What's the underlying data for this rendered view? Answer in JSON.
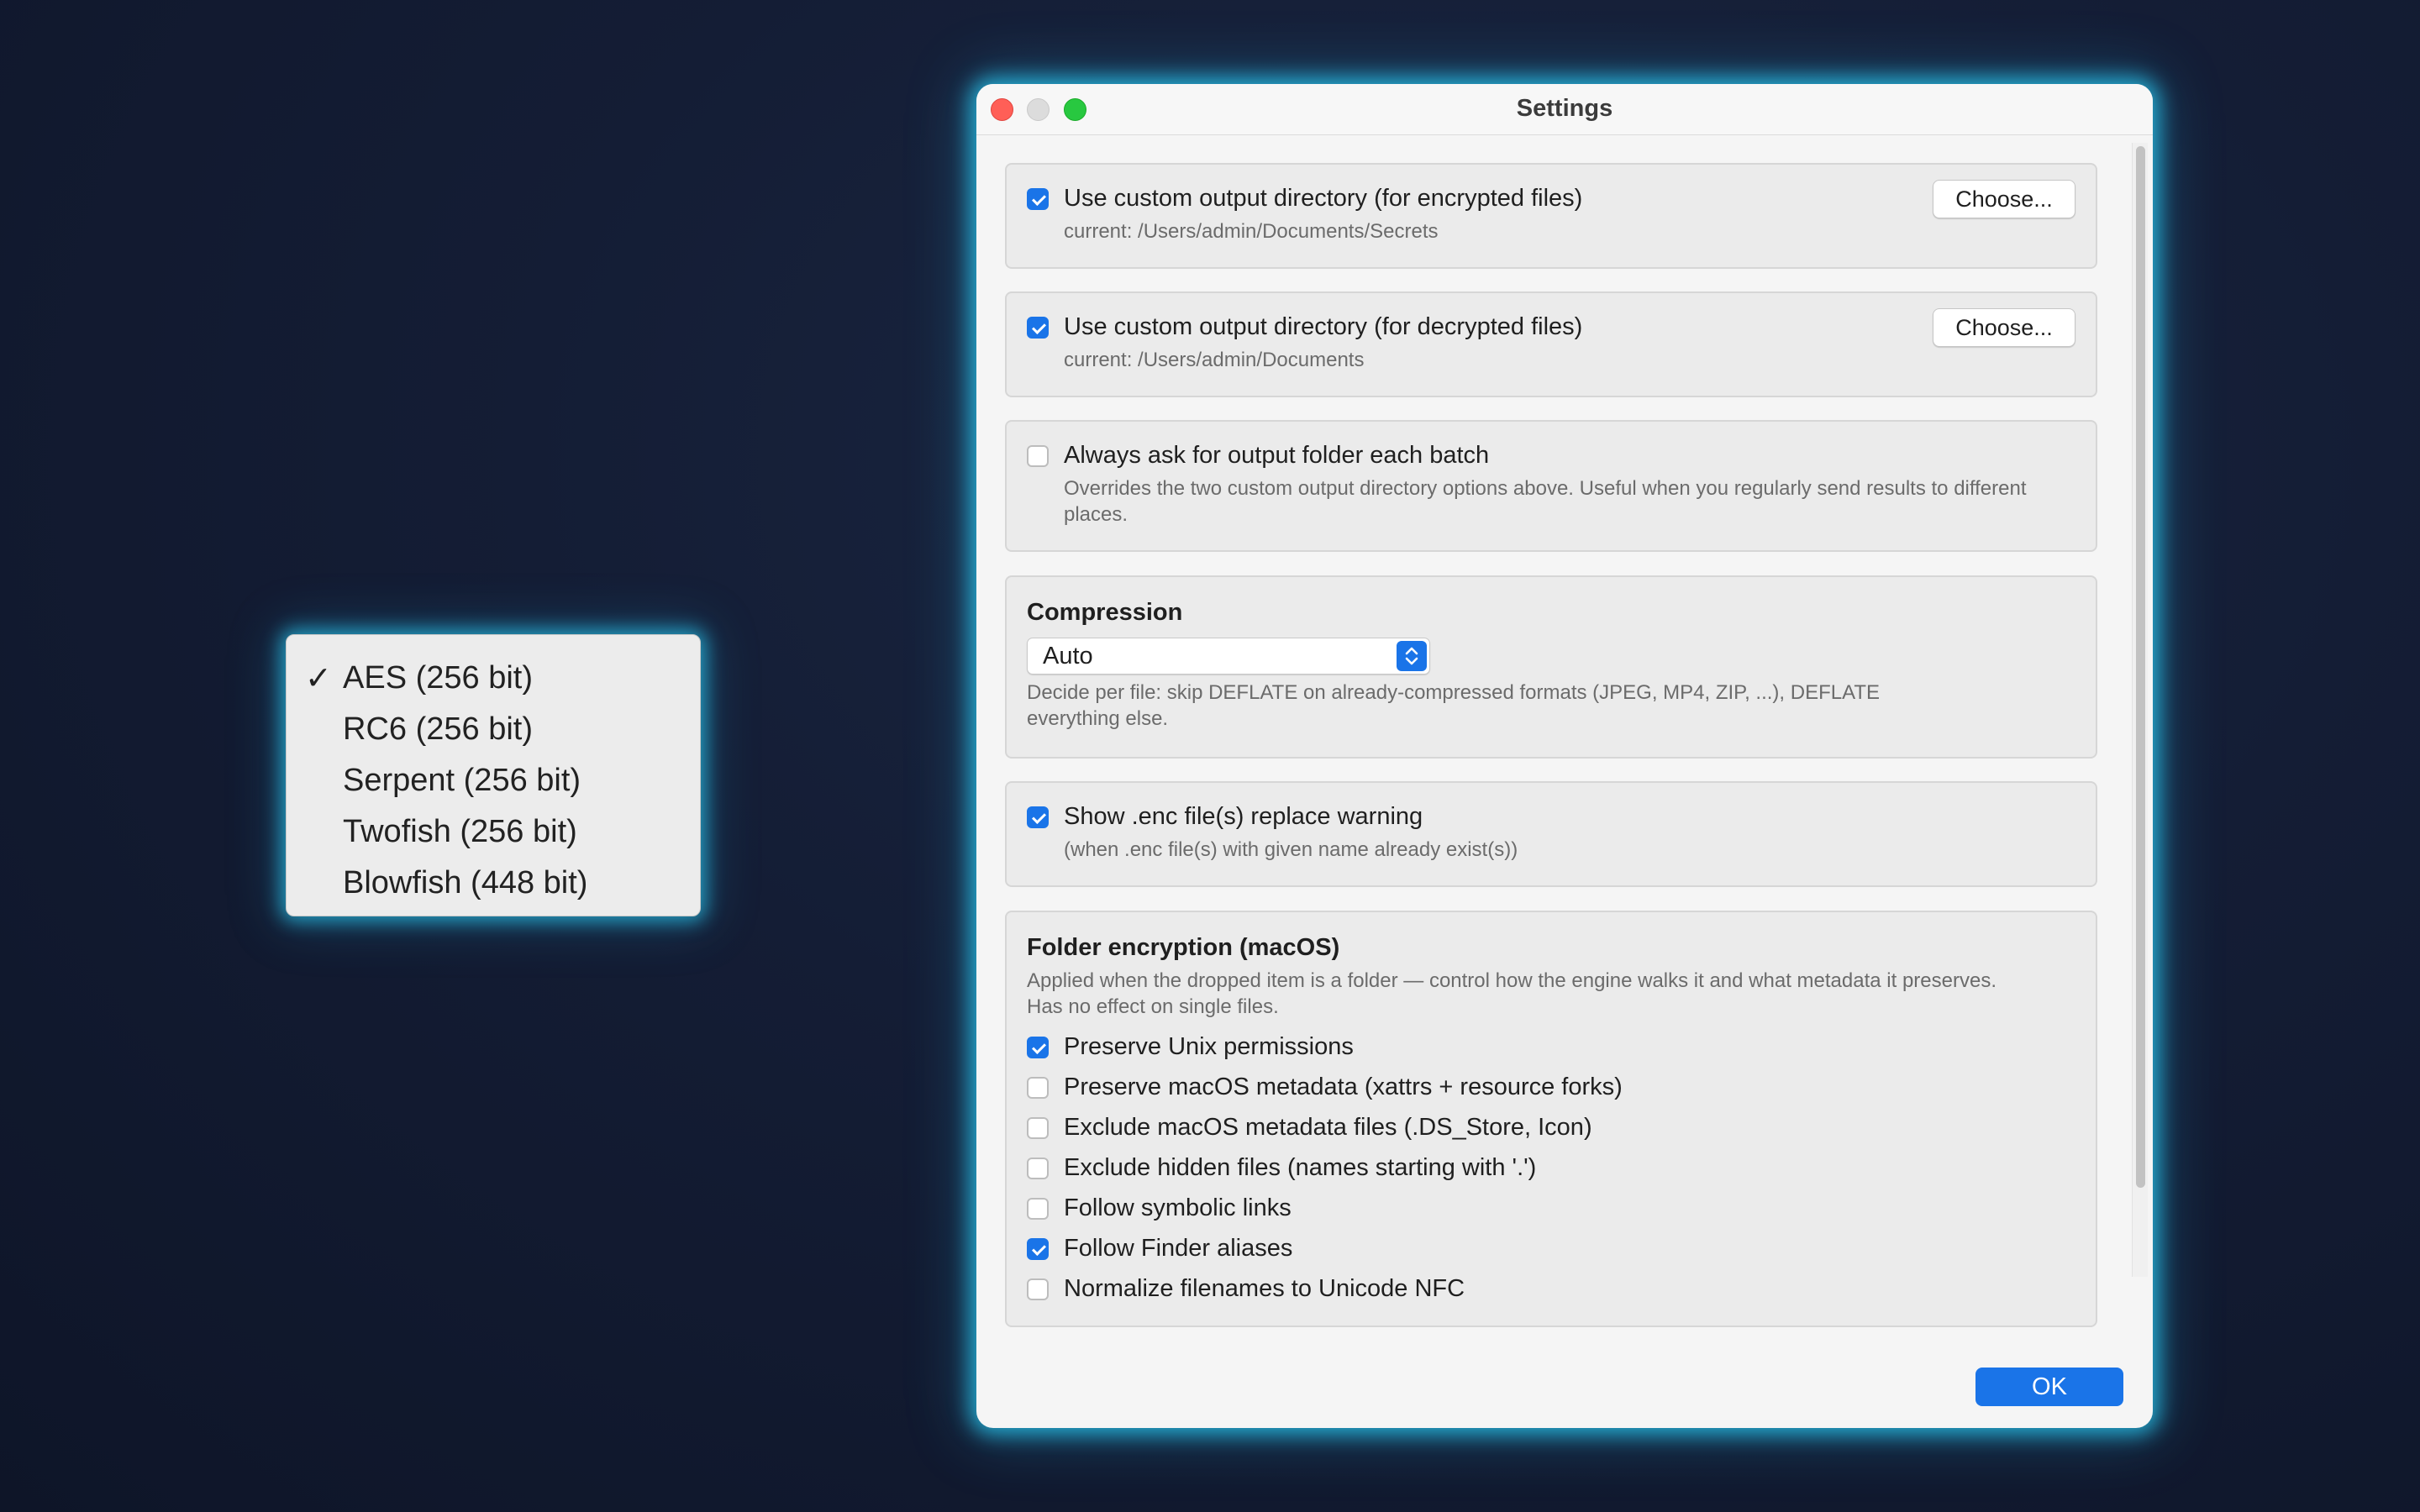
{
  "popup_menu": {
    "items": [
      {
        "label": "AES (256 bit)",
        "checked": true
      },
      {
        "label": "RC6 (256 bit)",
        "checked": false
      },
      {
        "label": "Serpent (256 bit)",
        "checked": false
      },
      {
        "label": "Twofish (256 bit)",
        "checked": false
      },
      {
        "label": "Blowfish (448 bit)",
        "checked": false
      }
    ],
    "check_glyph": "✓"
  },
  "window": {
    "title": "Settings",
    "encrypted_dir": {
      "checked": true,
      "label": "Use custom output directory (for encrypted files)",
      "current": "current: /Users/admin/Documents/Secrets",
      "button": "Choose..."
    },
    "decrypted_dir": {
      "checked": true,
      "label": "Use custom output directory (for decrypted files)",
      "current": "current: /Users/admin/Documents",
      "button": "Choose..."
    },
    "always_ask": {
      "checked": false,
      "label": "Always ask for output folder each batch",
      "description": "Overrides the two custom output directory options above. Useful when you regularly send results to different places."
    },
    "compression": {
      "heading": "Compression",
      "selected": "Auto",
      "description": "Decide per file: skip DEFLATE on already-compressed formats (JPEG, MP4, ZIP, ...), DEFLATE everything else."
    },
    "replace_warning": {
      "checked": true,
      "label": "Show .enc file(s) replace warning",
      "description": "(when .enc file(s) with given name already exist(s))"
    },
    "folder_encryption": {
      "heading": "Folder encryption (macOS)",
      "description": "Applied when the dropped item is a folder — control how the engine walks it and what metadata it preserves. Has no effect on single files.",
      "options": [
        {
          "label": "Preserve Unix permissions",
          "checked": true
        },
        {
          "label": "Preserve macOS metadata (xattrs + resource forks)",
          "checked": false
        },
        {
          "label": "Exclude macOS metadata files (.DS_Store, Icon)",
          "checked": false
        },
        {
          "label": "Exclude hidden files (names starting with '.')",
          "checked": false
        },
        {
          "label": "Follow symbolic links",
          "checked": false
        },
        {
          "label": "Follow Finder aliases",
          "checked": true
        },
        {
          "label": "Normalize filenames to Unicode NFC",
          "checked": false
        }
      ]
    },
    "ok_button": "OK"
  },
  "colors": {
    "accent": "#1a74e8",
    "glow": "#28c3eb",
    "background": "#141d35"
  }
}
